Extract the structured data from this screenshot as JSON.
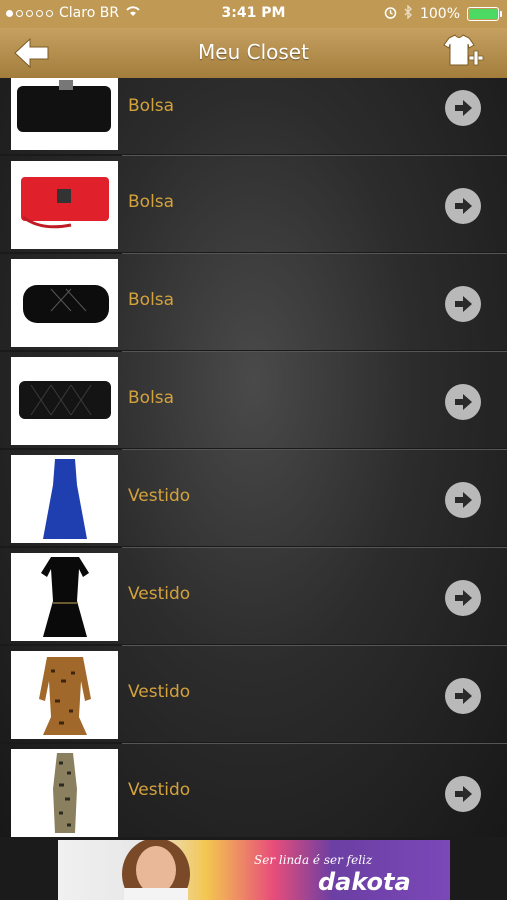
{
  "status": {
    "carrier": "Claro BR",
    "time": "3:41 PM",
    "battery": "100%"
  },
  "header": {
    "title": "Meu Closet",
    "back_icon": "back-arrow-icon",
    "add_icon": "add-clothing-icon"
  },
  "items": [
    {
      "label": "Bolsa",
      "image": "black-clutch-bag"
    },
    {
      "label": "Bolsa",
      "image": "red-clutch-bag"
    },
    {
      "label": "Bolsa",
      "image": "black-quilted-clutch"
    },
    {
      "label": "Bolsa",
      "image": "black-quilted-wallet"
    },
    {
      "label": "Vestido",
      "image": "blue-dress"
    },
    {
      "label": "Vestido",
      "image": "black-dress"
    },
    {
      "label": "Vestido",
      "image": "leopard-print-dress"
    },
    {
      "label": "Vestido",
      "image": "snake-print-dress"
    }
  ],
  "ad": {
    "tagline": "Ser linda é ser feliz",
    "brand": "dakota"
  },
  "colors": {
    "header_gold": "#b48c4a",
    "label_gold": "#d4a23c",
    "arrow_gray": "#b9b9b9"
  }
}
